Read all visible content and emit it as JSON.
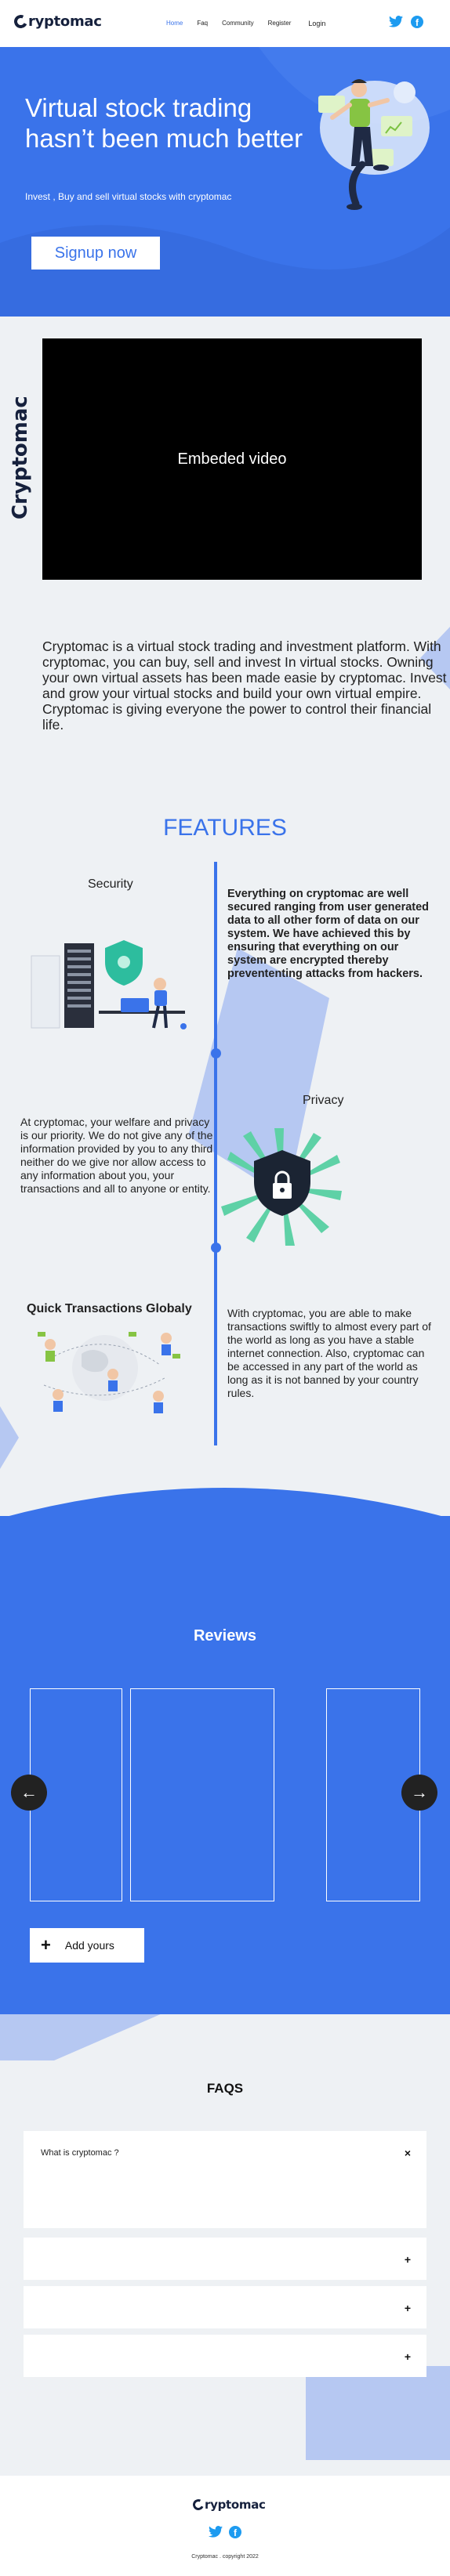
{
  "brand": {
    "name": "ryptomac",
    "initial": "C"
  },
  "nav": {
    "links": [
      "Home",
      "Faq",
      "Community",
      "Register"
    ],
    "login": "Login"
  },
  "social": {
    "twitter": "twitter-icon",
    "facebook": "facebook-icon",
    "facebook_letter": "f"
  },
  "hero": {
    "title": "Virtual stock trading hasn’t been much better",
    "subtitle": "Invest , Buy and sell  virtual stocks with cryptomac",
    "cta": "Signup now"
  },
  "video": {
    "side_logo": "Cryptomac",
    "placeholder": "Embeded video"
  },
  "about": {
    "text": "Cryptomac is a virtual stock trading and investment platform. With cryptomac, you can buy, sell and invest In virtual stocks. Owning your own virtual assets has been made easie by cryptomac. Invest and grow your virtual stocks and build your own virtual empire. Cryptomac is giving everyone the power to control their financial life."
  },
  "features": {
    "title": "FEATURES",
    "items": [
      {
        "heading": "Security",
        "text": "Everything on cryptomac are well secured ranging from user generated data to all other form of data on our system. We have achieved this by ensuring that everything on our system are encrypted thereby prevententing attacks from hackers."
      },
      {
        "heading": "Privacy",
        "text": "At cryptomac, your welfare and privacy is our priority. We do not give any of the information provided by you to any third neither do we give nor allow access to any information about you, your transactions and all to anyone or entity."
      },
      {
        "heading": "Quick Transactions Globaly",
        "text": "With cryptomac, you are able to make transactions swiftly to almost every part of the world as long as you have a stable internet connection. Also, cryptomac can be accessed in any part of the world as long as it is not banned by your country rules."
      }
    ]
  },
  "reviews": {
    "title": "Reviews",
    "prev_icon": "arrow-left-icon",
    "next_icon": "arrow-right-icon",
    "prev_glyph": "←",
    "next_glyph": "→",
    "add_label": "Add yours",
    "add_glyph": "+"
  },
  "faqs": {
    "title": "FAQS",
    "items": [
      {
        "question": "What is cryptomac ?",
        "sign": "×"
      },
      {
        "question": "",
        "sign": "+"
      },
      {
        "question": "",
        "sign": "+"
      },
      {
        "question": "",
        "sign": "+"
      }
    ]
  },
  "footer": {
    "copyright": "Cryptomac . copyright 2022"
  },
  "colors": {
    "primary": "#3a73ea",
    "dark": "#16213d",
    "accent_light": "#b6c8f2",
    "twitter": "#1d9bf0"
  }
}
